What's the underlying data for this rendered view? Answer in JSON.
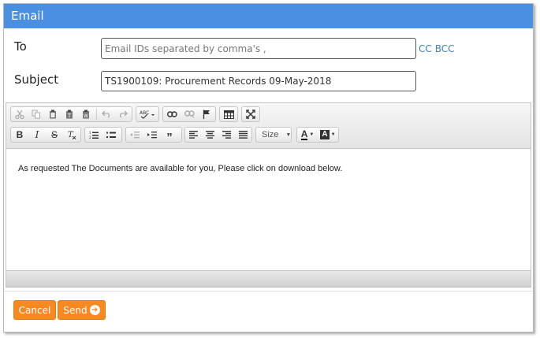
{
  "dialog": {
    "title": "Email"
  },
  "form": {
    "to_label": "To",
    "to_placeholder": "Email IDs separated by comma's ,",
    "cc_label": "CC",
    "bcc_label": "BCC",
    "subject_label": "Subject",
    "subject_value": "TS1900109: Procurement Records 09-May-2018"
  },
  "toolbar": {
    "bold": "B",
    "italic": "I",
    "strike": "S",
    "blockquote": "”",
    "size_label": "Size",
    "text_color": "A",
    "bg_color": "A"
  },
  "editor": {
    "body_text": "As requested The Documents are available for you, Please click on download below."
  },
  "buttons": {
    "cancel": "Cancel",
    "send": "Send"
  }
}
